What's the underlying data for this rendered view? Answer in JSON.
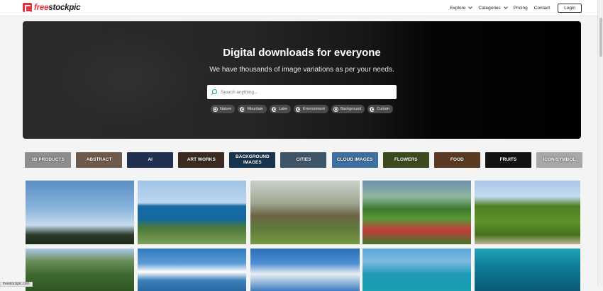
{
  "header": {
    "logo_brand": "free",
    "logo_rest": "stockpic",
    "nav": [
      {
        "label": "Explore",
        "dropdown": true
      },
      {
        "label": "Categories",
        "dropdown": true
      },
      {
        "label": "Pricing",
        "dropdown": false
      },
      {
        "label": "Contact",
        "dropdown": false
      }
    ],
    "login_label": "Login"
  },
  "hero": {
    "title": "Digital downloads for everyone",
    "subtitle": "We have thousands of image variations as per your needs.",
    "search_placeholder": "Search anything...",
    "chips": [
      "Nature",
      "Mountain",
      "Lake",
      "Environment",
      "Background",
      "Curtain"
    ]
  },
  "categories": [
    {
      "label": "3D PRODUCTS",
      "color": "#8d8d8d"
    },
    {
      "label": "ABSTRACT",
      "color": "#6d5a4a"
    },
    {
      "label": "AI",
      "color": "#1f3050"
    },
    {
      "label": "ART WORKS",
      "color": "#3a2a1f"
    },
    {
      "label": "BACKGROUND IMAGES",
      "color": "#17344f"
    },
    {
      "label": "CITIES",
      "color": "#3f5668"
    },
    {
      "label": "CLOUD IMAGES",
      "color": "#3d6fa3"
    },
    {
      "label": "FLOWERS",
      "color": "#3c4a1e"
    },
    {
      "label": "FOOD",
      "color": "#5a3a22"
    },
    {
      "label": "FRUITS",
      "color": "#121212"
    },
    {
      "label": "ICON/SYMBOL",
      "color": "#a7a7a7"
    }
  ],
  "gallery": [
    {
      "name": "sky-with-clouds",
      "bg": "linear-gradient(180deg,#5a8ec6 0%,#8bb5dd 45%,#c7dcef 70%,#2d3b2a 85%,#1b2a18 100%)"
    },
    {
      "name": "coast-sea",
      "bg": "linear-gradient(180deg,#9fc4e6 0%,#bcd6ee 35%,#1a6aa6 40%,#12699f 60%,#4e7a36 75%,#7ca05a 100%)"
    },
    {
      "name": "village-cottages",
      "bg": "linear-gradient(180deg,#c9d2c9 0%,#a0a890 35%,#6b6447 55%,#5e7a3b 75%,#77993f 100%)"
    },
    {
      "name": "rainbow-flowers",
      "bg": "linear-gradient(180deg,#6e8fb0 0%,#8fb6a0 25%,#3c7a2e 45%,#5a9a35 60%,#c43a3a 78%,#3b7a2a 100%)"
    },
    {
      "name": "vineyard",
      "bg": "linear-gradient(180deg,#a9c8e8 0%,#c4daf0 25%,#4c7f22 40%,#5f9228 65%,#46701c 85%,#b9b397 100%)"
    },
    {
      "name": "green-valley",
      "bg": "linear-gradient(180deg,#a9c8e8 0%,#6b8d5a 30%,#3f6a2f 60%,#2f5622 100%)"
    },
    {
      "name": "sea-clouds",
      "bg": "linear-gradient(180deg,#2f78c0 0%,#5d9bd6 35%,#ffffff 55%,#3c80b8 75%,#2a6aa3 100%)"
    },
    {
      "name": "blue-sky-clouds",
      "bg": "linear-gradient(180deg,#2b6fb8 0%,#4d8fd3 35%,#e8eef4 60%,#3d7fc0 100%)"
    },
    {
      "name": "turquoise-sea",
      "bg": "linear-gradient(180deg,#5aa6d8 0%,#7fbbe0 30%,#1f9ab8 60%,#18a0b0 100%)"
    },
    {
      "name": "underwater",
      "bg": "linear-gradient(180deg,#1fa3b8 0%,#0f7f98 40%,#0b5a74 100%)"
    }
  ],
  "status_url": "freestockpic.com"
}
